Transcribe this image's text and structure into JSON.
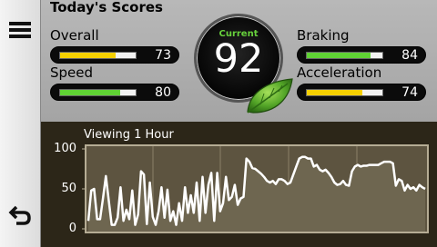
{
  "title": "Today's Scores",
  "scores": {
    "overall": {
      "label": "Overall",
      "value": 73,
      "color": "#f5d000"
    },
    "speed": {
      "label": "Speed",
      "value": 80,
      "color": "#5fd234"
    },
    "braking": {
      "label": "Braking",
      "value": 84,
      "color": "#5fd234"
    },
    "acceleration": {
      "label": "Acceleration",
      "value": 74,
      "color": "#f5d000"
    }
  },
  "current": {
    "label": "Current",
    "value": 92
  },
  "icons": {
    "menu": "hamburger-menu-icon",
    "back": "back-arrow-icon",
    "leaf": "eco-leaf-icon"
  },
  "chart_data": {
    "type": "area",
    "title": "Viewing 1 Hour",
    "y_ticks": [
      "100",
      "50",
      "0"
    ],
    "ylim": [
      0,
      100
    ],
    "grid": true,
    "series": [
      {
        "values": [
          10,
          48,
          50,
          12,
          12,
          38,
          66,
          35,
          5,
          5,
          14,
          52,
          10,
          24,
          12,
          48,
          5,
          18,
          72,
          68,
          6,
          58,
          15,
          5,
          22,
          52,
          14,
          49,
          10,
          22,
          5,
          32,
          10,
          52,
          20,
          42,
          20,
          58,
          10,
          65,
          20,
          55,
          70,
          10,
          70,
          22,
          32,
          65,
          36,
          40,
          55,
          30,
          38,
          40,
          88,
          84,
          76,
          75,
          72,
          69,
          65,
          60,
          58,
          60,
          56,
          62,
          62,
          60,
          56,
          58,
          68,
          78,
          88,
          90,
          90,
          88,
          88,
          78,
          80,
          74,
          72,
          74,
          70,
          65,
          58,
          55,
          56,
          60,
          55,
          54,
          72,
          78,
          80,
          78,
          79,
          79,
          80,
          80,
          80,
          80,
          82,
          84,
          84,
          84,
          82,
          54,
          62,
          60,
          48,
          55,
          50,
          52,
          48,
          55,
          52,
          50
        ]
      }
    ]
  }
}
